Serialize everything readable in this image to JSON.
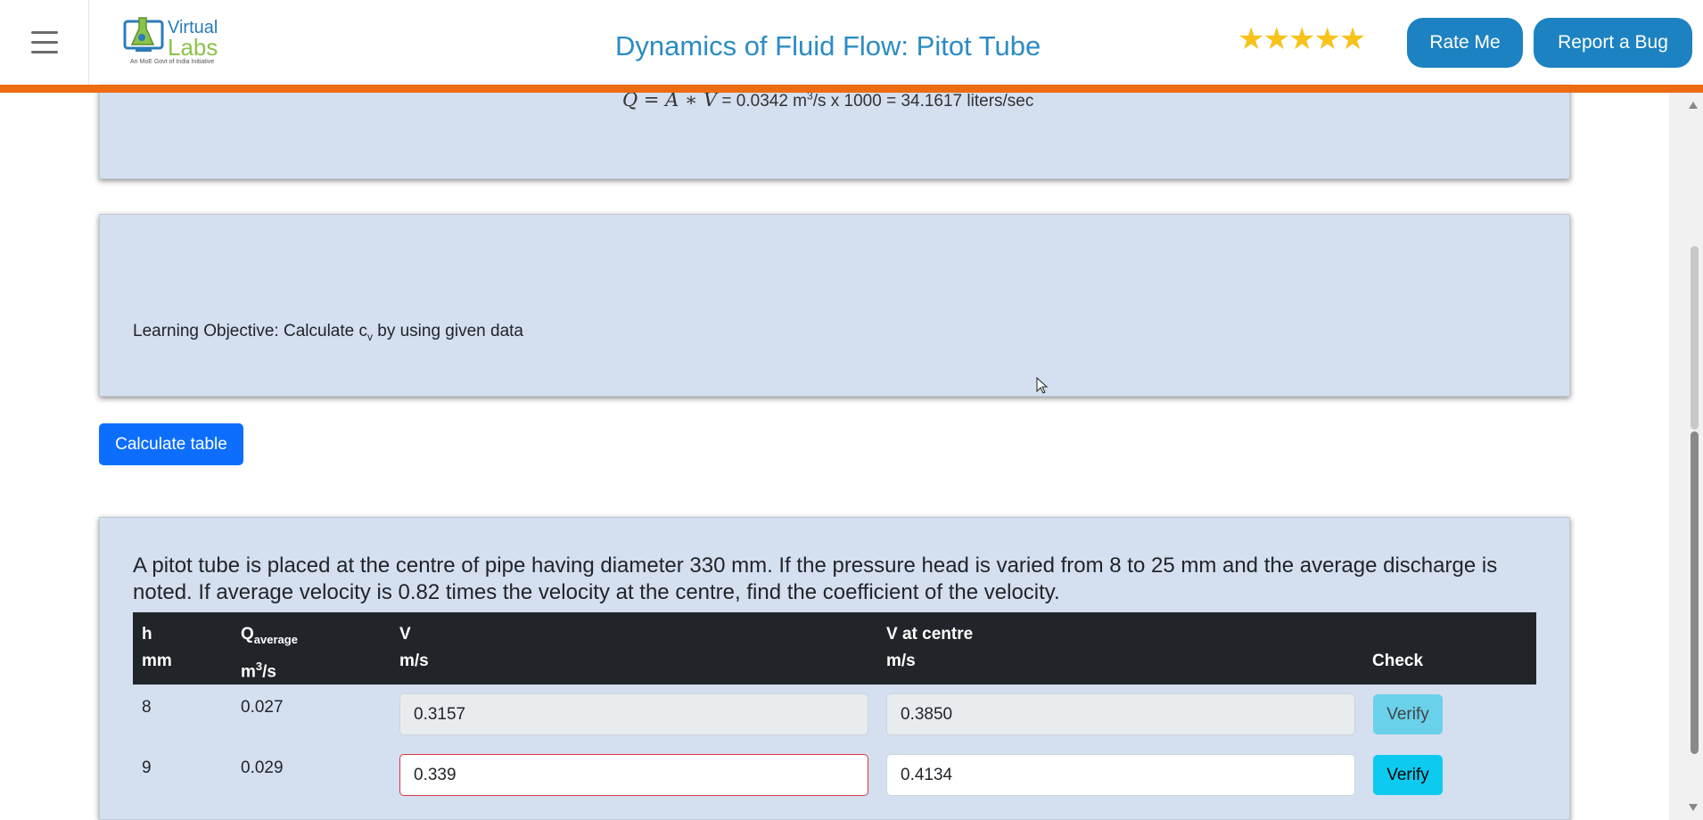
{
  "header": {
    "title": "Dynamics of Fluid Flow: Pitot Tube",
    "logo_line1": "Virtual",
    "logo_line2": "Labs",
    "logo_sub": "An MoE Govt of India Initiative",
    "rating_stars": "★★★★★",
    "rate_button": "Rate Me",
    "bug_button": "Report a Bug",
    "accent_color": "#ec6b13"
  },
  "formula": {
    "lhs": "Q = A ∗ V",
    "rhs_a": " = 0.0342 m",
    "rhs_exp": "3",
    "rhs_b": "/s x 1000 = 34.1617 liters/sec"
  },
  "objective": {
    "text_a": "Learning Objective: Calculate c",
    "sub": "v",
    "text_b": " by using given data"
  },
  "calculate_button": "Calculate table",
  "question": "A pitot tube is placed at the centre of pipe having diameter 330 mm. If the pressure head is varied from 8 to 25 mm and the average discharge is noted. If average velocity is 0.82 times the velocity at the centre, find the coefficient of the velocity.",
  "table": {
    "headers": {
      "h": "h",
      "h_unit": "mm",
      "q": "Q",
      "q_sub": "average",
      "q_unit_a": "m",
      "q_unit_sup": "3",
      "q_unit_b": "/s",
      "v": "V",
      "v_unit": "m/s",
      "vc": "V at centre",
      "vc_unit": "m/s",
      "check": "Check"
    },
    "rows": [
      {
        "h": "8",
        "q": "0.027",
        "v": "0.3157",
        "vc": "0.3850",
        "verify": "Verify"
      },
      {
        "h": "9",
        "q": "0.029",
        "v": "0.339",
        "vc": "0.4134",
        "verify": "Verify"
      }
    ]
  }
}
